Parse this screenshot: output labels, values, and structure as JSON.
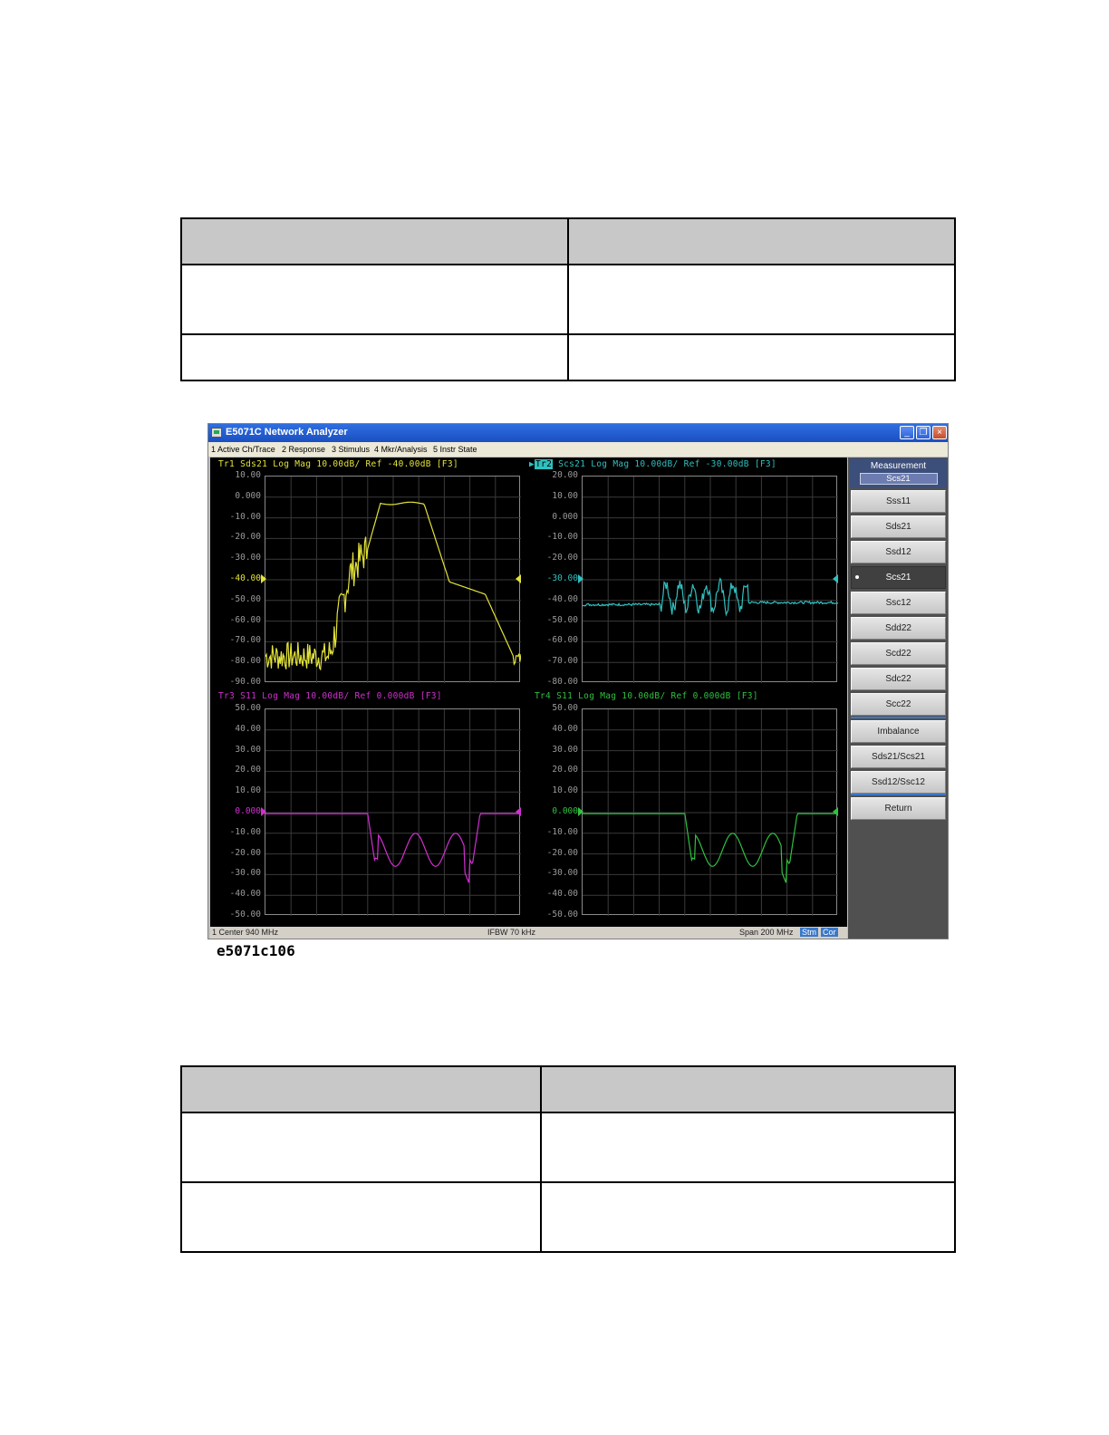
{
  "window": {
    "title": "E5071C Network Analyzer",
    "controls": {
      "minimize": "_",
      "restore": "❐",
      "close": "×"
    }
  },
  "menu": [
    "1 Active Ch/Trace",
    "2 Response",
    "3 Stimulus",
    "4 Mkr/Analysis",
    "5 Instr State"
  ],
  "traces": [
    {
      "id": "tr1",
      "header": "Tr1 Sds21 Log Mag 10.00dB/ Ref -40.00dB [F3]",
      "color": "#e3e33a",
      "yticks": [
        "10.00",
        "0.000",
        "-10.00",
        "-20.00",
        "-30.00",
        "-40.00",
        "-50.00",
        "-60.00",
        "-70.00",
        "-80.00",
        "-90.00"
      ],
      "ymax": 10,
      "ymin": -90,
      "ref": -40
    },
    {
      "id": "tr2",
      "badge": "Tr2",
      "header": "Scs21 Log Mag 10.00dB/ Ref -30.00dB [F3]",
      "color": "#30c0c0",
      "yticks": [
        "20.00",
        "10.00",
        "0.000",
        "-10.00",
        "-20.00",
        "-30.00",
        "-40.00",
        "-50.00",
        "-60.00",
        "-70.00",
        "-80.00"
      ],
      "ymax": 20,
      "ymin": -80,
      "ref": -30
    },
    {
      "id": "tr3",
      "header": "Tr3 S11 Log Mag 10.00dB/ Ref 0.000dB [F3]",
      "color": "#d030d0",
      "yticks": [
        "50.00",
        "40.00",
        "30.00",
        "20.00",
        "10.00",
        "0.000",
        "-10.00",
        "-20.00",
        "-30.00",
        "-40.00",
        "-50.00"
      ],
      "ymax": 50,
      "ymin": -50,
      "ref": 0
    },
    {
      "id": "tr4",
      "header": "Tr4 S11 Log Mag 10.00dB/ Ref 0.000dB [F3]",
      "color": "#30c040",
      "yticks": [
        "50.00",
        "40.00",
        "30.00",
        "20.00",
        "10.00",
        "0.000",
        "-10.00",
        "-20.00",
        "-30.00",
        "-40.00",
        "-50.00"
      ],
      "ymax": 50,
      "ymin": -50,
      "ref": 0
    }
  ],
  "status": {
    "center": "1  Center 940 MHz",
    "ifbw": "IFBW 70 kHz",
    "span": "Span 200 MHz",
    "badge1": "Stm",
    "badge2": "Cor"
  },
  "softkeys": {
    "title": "Measurement",
    "current": "Scs21",
    "items": [
      "Sss11",
      "Sds21",
      "Ssd12",
      "Scs21",
      "Ssc12",
      "Sdd22",
      "Scd22",
      "Sdc22",
      "Scc22",
      "Imbalance",
      "Sds21/Scs21",
      "Ssd12/Ssc12",
      "Return"
    ],
    "active_index": 3
  },
  "caption": "e5071c106"
}
